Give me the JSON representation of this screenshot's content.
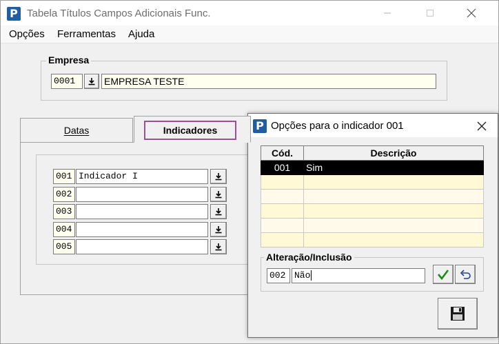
{
  "window": {
    "title": "Tabela Títulos Campos Adicionais Func."
  },
  "menu": [
    "Opções",
    "Ferramentas",
    "Ajuda"
  ],
  "empresa": {
    "label": "Empresa",
    "code": "0001",
    "name": "EMPRESA TESTE"
  },
  "tabs": [
    {
      "label": "Datas",
      "active": false
    },
    {
      "label": "Indicadores",
      "active": true
    }
  ],
  "indicators": [
    {
      "code": "001",
      "value": "Indicador I"
    },
    {
      "code": "002",
      "value": ""
    },
    {
      "code": "003",
      "value": ""
    },
    {
      "code": "004",
      "value": ""
    },
    {
      "code": "005",
      "value": ""
    }
  ],
  "dialog": {
    "title": "Opções para o indicador 001",
    "columns": [
      "Cód.",
      "Descrição"
    ],
    "rows": [
      {
        "code": "001",
        "desc": "Sim"
      },
      {
        "code": "",
        "desc": ""
      },
      {
        "code": "",
        "desc": ""
      },
      {
        "code": "",
        "desc": ""
      },
      {
        "code": "",
        "desc": ""
      },
      {
        "code": "",
        "desc": ""
      }
    ],
    "edit": {
      "label": "Alteração/Inclusão",
      "code": "002",
      "desc": "Não"
    }
  },
  "colors": {
    "accent_tab_border": "#9b4f9b",
    "selected_row": "#000000",
    "confirm_green": "#1a8a1a",
    "icon_blue": "#1f5f9f"
  }
}
